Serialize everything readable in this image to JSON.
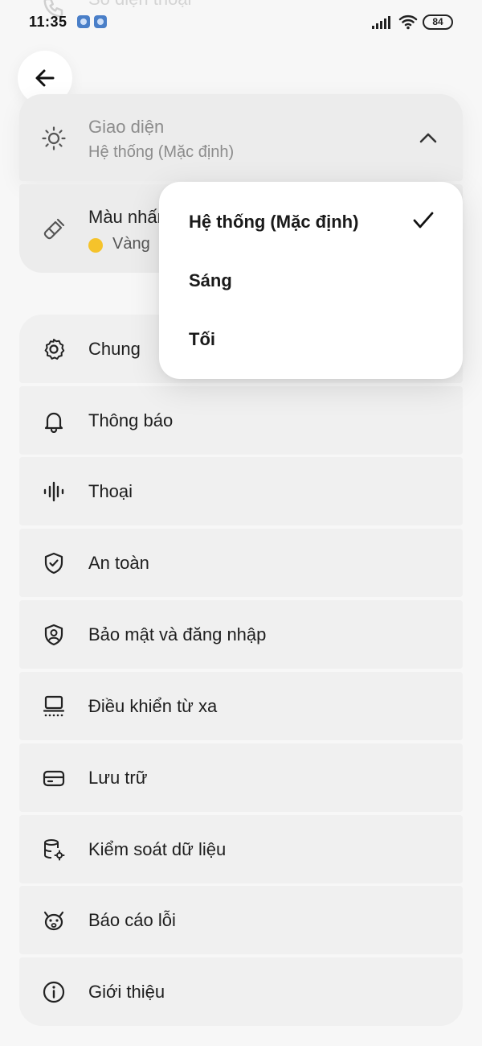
{
  "status_bar": {
    "time": "11:35",
    "battery": "84",
    "ghost_text": "Số điện thoại"
  },
  "back": {
    "icon": "arrow-left-icon"
  },
  "appearance": {
    "title": "Giao diện",
    "value": "Hệ thống (Mặc định)",
    "icon": "sun-icon"
  },
  "accent": {
    "title": "Màu nhấn",
    "value": "Vàng",
    "color": "#f5c32b",
    "icon": "paintbrush-icon"
  },
  "dropdown": {
    "options": [
      {
        "label": "Hệ thống (Mặc định)",
        "selected": true
      },
      {
        "label": "Sáng",
        "selected": false
      },
      {
        "label": "Tối",
        "selected": false
      }
    ]
  },
  "menu": {
    "items": [
      {
        "label": "Chung",
        "icon": "gear-icon"
      },
      {
        "label": "Thông báo",
        "icon": "bell-icon"
      },
      {
        "label": "Thoại",
        "icon": "voice-wave-icon"
      },
      {
        "label": "An toàn",
        "icon": "shield-check-icon"
      },
      {
        "label": "Bảo mật và đăng nhập",
        "icon": "user-shield-icon"
      },
      {
        "label": "Điều khiển từ xa",
        "icon": "remote-computer-icon"
      },
      {
        "label": "Lưu trữ",
        "icon": "storage-drive-icon"
      },
      {
        "label": "Kiểm soát dữ liệu",
        "icon": "database-settings-icon"
      },
      {
        "label": "Báo cáo lỗi",
        "icon": "bug-icon"
      },
      {
        "label": "Giới thiệu",
        "icon": "info-icon"
      }
    ]
  }
}
